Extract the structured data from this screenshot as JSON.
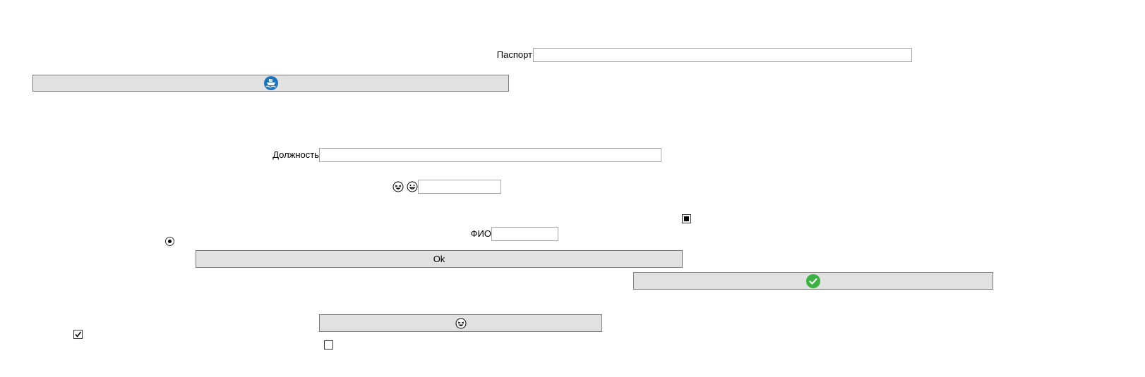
{
  "passport": {
    "label": "Паспорт",
    "value": ""
  },
  "position": {
    "label": "Должность",
    "value": ""
  },
  "fio": {
    "label": "ФИО",
    "value": ""
  },
  "emoji_field": {
    "value": ""
  },
  "buttons": {
    "ship_icon": "ship-icon",
    "ok_label": "Ok",
    "check_icon": "check-icon",
    "emoji_icon": "laughing-face-icon"
  },
  "checkboxes": {
    "top_right_state": "indeterminate",
    "bottom_left_checked": true,
    "bottom_middle_checked": false
  },
  "radio": {
    "selected": true
  },
  "colors": {
    "button_bg": "#e1e1e1",
    "button_border": "#7a7a7a",
    "ship_blue": "#1e73be",
    "check_green": "#3cb043"
  }
}
